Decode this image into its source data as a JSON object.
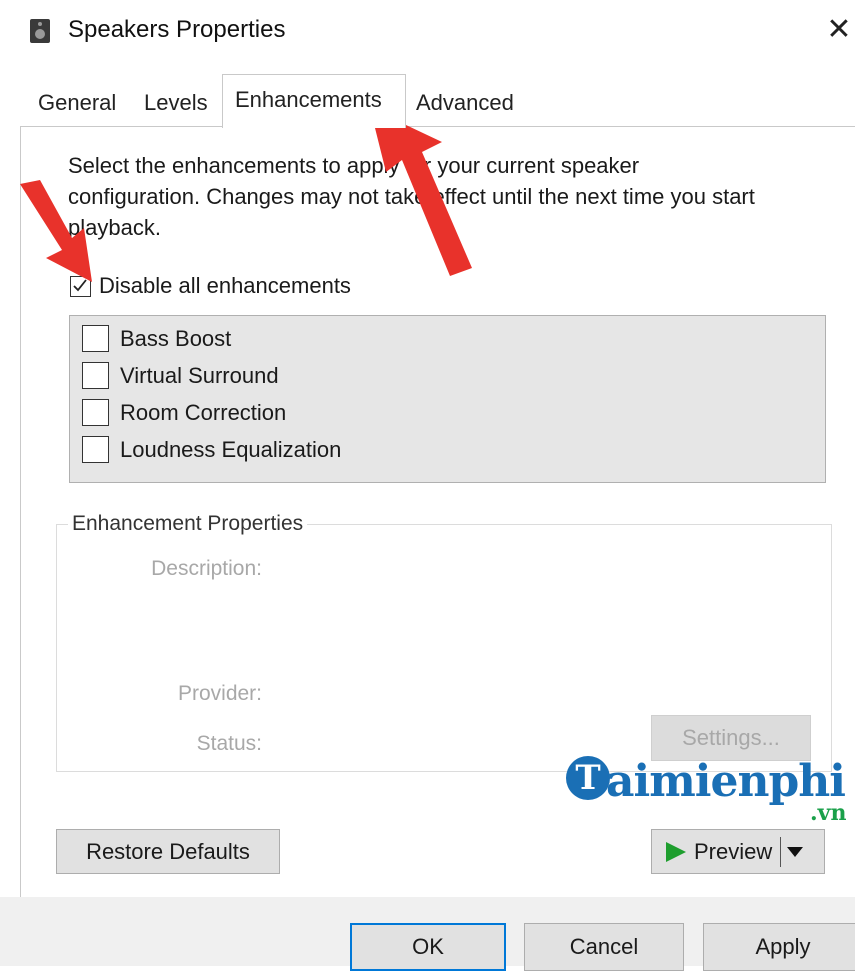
{
  "window": {
    "title": "Speakers Properties",
    "close_glyph": "✕",
    "app_icon": "speaker-icon"
  },
  "tabs": [
    {
      "label": "General",
      "active": false
    },
    {
      "label": "Levels",
      "active": false
    },
    {
      "label": "Enhancements",
      "active": true
    },
    {
      "label": "Advanced",
      "active": false
    }
  ],
  "intro_text": "Select the enhancements to apply for your current speaker configuration. Changes may not take effect until the next time you start playback.",
  "intro_lines": [
    "Select the enhancements to apply for your current speaker",
    "configuration. Changes may not take effect until the next time you start",
    "playback."
  ],
  "disable_all": {
    "label": "Disable all enhancements",
    "checked": true
  },
  "enhancements": [
    {
      "label": "Bass Boost",
      "checked": false
    },
    {
      "label": "Virtual Surround",
      "checked": false
    },
    {
      "label": "Room Correction",
      "checked": false
    },
    {
      "label": "Loudness Equalization",
      "checked": false
    }
  ],
  "properties": {
    "group_label": "Enhancement Properties",
    "description_label": "Description:",
    "provider_label": "Provider:",
    "status_label": "Status:",
    "settings_button": "Settings..."
  },
  "buttons": {
    "restore_defaults": "Restore Defaults",
    "preview": "Preview",
    "ok": "OK",
    "cancel": "Cancel",
    "apply": "Apply"
  },
  "watermark": {
    "brand_initial": "T",
    "brand": "aimienphi",
    "suffix": ".vn"
  },
  "colors": {
    "arrow": "#e8322b",
    "preview_play": "#1e9e2e",
    "watermark_blue": "#1a6fb5",
    "watermark_green": "#1aa04a"
  }
}
